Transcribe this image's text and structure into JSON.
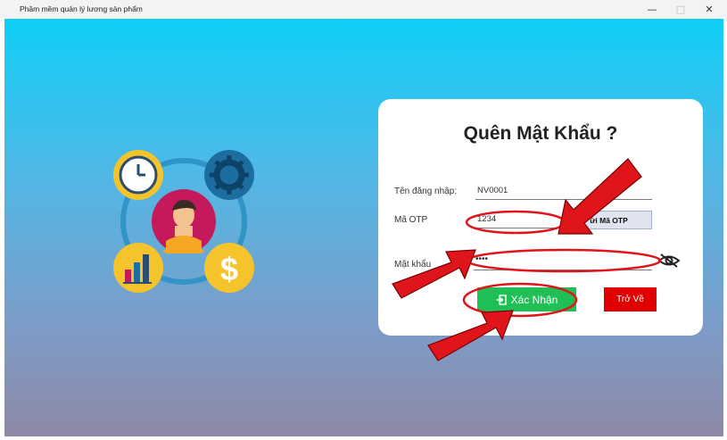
{
  "window": {
    "title": "Phầm mềm quản lý lương sản phẩm",
    "minimize_icon": "minimize-icon",
    "maximize_icon": "maximize-icon",
    "close_icon": "close-icon"
  },
  "colors": {
    "bg_top": "#0fcff7",
    "bg_bottom": "#8d89a6",
    "confirm": "#1fbf55",
    "back": "#e00000",
    "highlight": "#e0151b"
  },
  "illustration": {
    "center": "user-avatar-icon",
    "top_left": "clock-icon",
    "top_right": "gear-icon",
    "bottom_left": "bar-chart-icon",
    "bottom_right": "dollar-icon"
  },
  "form": {
    "title": "Quên Mật Khẩu ?",
    "username_label": "Tên đăng nhập:",
    "username_value": "NV0001",
    "otp_label": "Mã OTP",
    "otp_value": "1234",
    "otp_button": "ửi Mã OTP",
    "password_label": "Mật khẩu",
    "password_value": "••••",
    "show_password_icon": "eye-slash-icon",
    "confirm_label": "Xác Nhận",
    "confirm_icon": "login-icon",
    "back_label": "Trở Về"
  }
}
